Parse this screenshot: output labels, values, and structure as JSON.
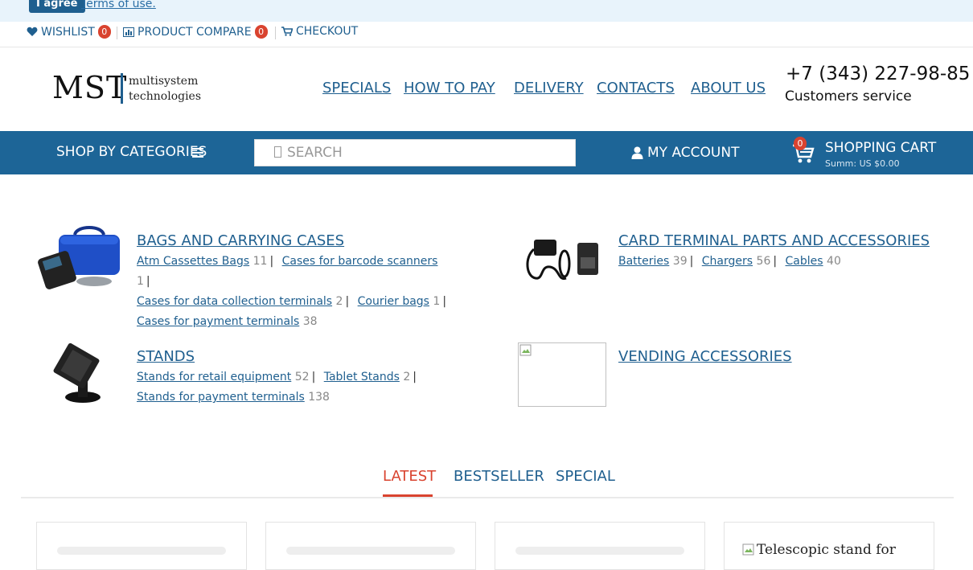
{
  "cookie": {
    "agree_label": "I agree",
    "terms_link": "Terms of use."
  },
  "topbar": {
    "wishlist_label": "WISHLIST",
    "wishlist_count": "0",
    "compare_label": "PRODUCT COMPARE",
    "compare_count": "0",
    "checkout_label": "CHECKOUT"
  },
  "logo": {
    "mark": "MST",
    "line1": "multisystem",
    "line2": "technologies"
  },
  "nav": {
    "items": [
      "SPECIALS",
      "HOW TO PAY",
      "DELIVERY",
      "CONTACTS",
      "ABOUT US"
    ]
  },
  "contact": {
    "phone": "+7 (343) 227-98-85",
    "label": "Customers service"
  },
  "bluebar": {
    "shop_by_categories": "SHOP BY CATEGORIES",
    "search_placeholder": "SEARCH",
    "account_label": "MY ACCOUNT",
    "cart_title": "SHOPPING CART",
    "cart_sum": "Summ: US $0.00",
    "cart_count": "0"
  },
  "categories": [
    {
      "title": "BAGS AND CARRYING CASES",
      "subs": [
        {
          "name": "Atm Cassettes Bags",
          "count": "11"
        },
        {
          "name": "Cases for barcode scanners",
          "count": "1"
        },
        {
          "name": "Cases for data collection terminals",
          "count": "2"
        },
        {
          "name": "Courier bags",
          "count": "1"
        },
        {
          "name": "Cases for payment terminals",
          "count": "38"
        }
      ]
    },
    {
      "title": "CARD TERMINAL PARTS AND ACCESSORIES",
      "subs": [
        {
          "name": "Batteries",
          "count": "39"
        },
        {
          "name": "Chargers",
          "count": "56"
        },
        {
          "name": "Cables",
          "count": "40"
        }
      ]
    },
    {
      "title": "STANDS",
      "subs": [
        {
          "name": "Stands for retail equipment",
          "count": "52"
        },
        {
          "name": "Tablet Stands",
          "count": "2"
        },
        {
          "name": "Stands for payment terminals",
          "count": "138"
        }
      ]
    },
    {
      "title": "VENDING ACCESSORIES",
      "subs": []
    }
  ],
  "tabs": {
    "items": [
      "LATEST",
      "BESTSELLER",
      "SPECIAL"
    ],
    "active": "LATEST"
  },
  "products": {
    "card4_alt": "Telescopic stand for"
  },
  "colors": {
    "brand_blue": "#1d6597",
    "accent_red": "#d9432f",
    "link_blue": "#1f5f8f"
  }
}
